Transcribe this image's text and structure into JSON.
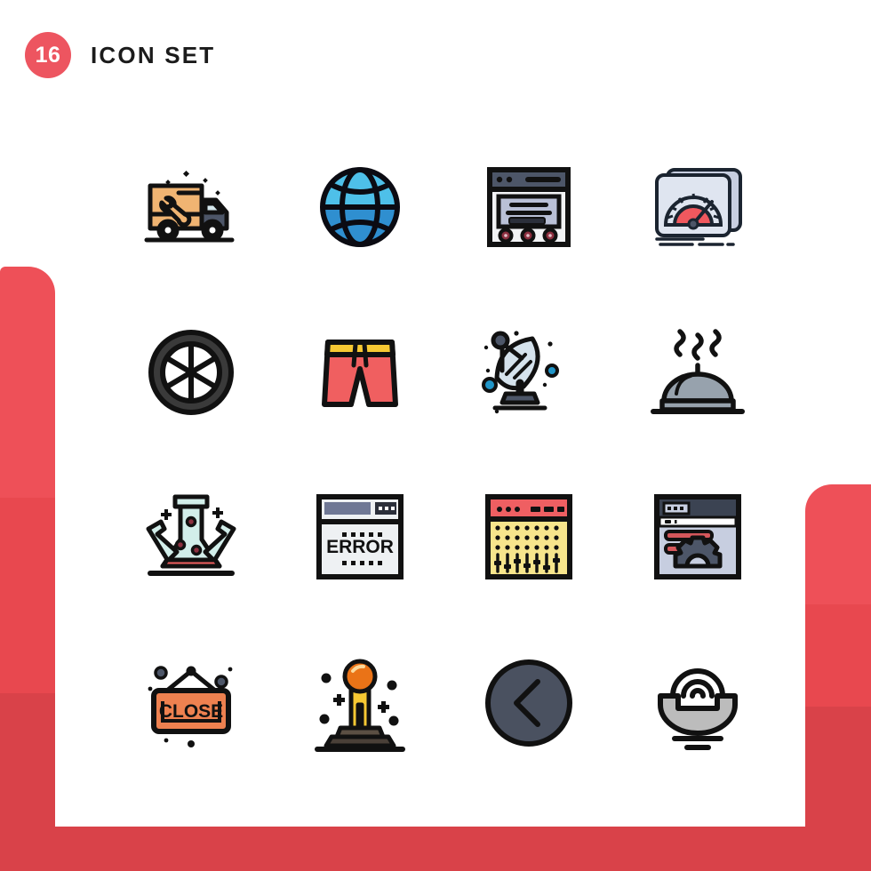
{
  "header": {
    "count": "16",
    "title": "Icon Set",
    "badge_color": "#ed5560",
    "title_color": "#1b1b1b"
  },
  "decor": {
    "ribbon_color": "#ee5058",
    "ribbon_shade_a": "#e8484f",
    "ribbon_shade_b": "#d94249",
    "background": "#ffffff"
  },
  "grid": {
    "columns": 4,
    "rows": 4,
    "total_icons": 16
  },
  "icons": [
    {
      "index": 1,
      "row": 1,
      "col": 1,
      "name": "service-truck-icon",
      "label": "Service Truck",
      "colors": {
        "body": "#f0b472",
        "cab": "#4d5668",
        "window": "#d6e9ee",
        "stroke": "#111111"
      }
    },
    {
      "index": 2,
      "row": 1,
      "col": 2,
      "name": "globe-icon",
      "label": "Globe",
      "colors": {
        "light": "#4ec0e9",
        "mid": "#3aa8dd",
        "dark": "#2f8fd0",
        "stroke": "#0b0b12"
      }
    },
    {
      "index": 3,
      "row": 1,
      "col": 3,
      "name": "web-page-icon",
      "label": "Web Page",
      "colors": {
        "titlebar": "#4d5668",
        "content": "#b9c0d6",
        "base": "#f2f3f5",
        "dot": "#8c2f3f",
        "stroke": "#111111"
      }
    },
    {
      "index": 4,
      "row": 1,
      "col": 4,
      "name": "speedometer-icon",
      "label": "Speedometer",
      "colors": {
        "case": "#c7cee0",
        "face": "#dfe5f0",
        "dial": "#f0585e",
        "stroke": "#1b2430"
      }
    },
    {
      "index": 5,
      "row": 2,
      "col": 1,
      "name": "wheel-icon",
      "label": "Wheel",
      "colors": {
        "tire": "#3a3a3a",
        "stroke": "#111111"
      }
    },
    {
      "index": 6,
      "row": 2,
      "col": 2,
      "name": "shorts-icon",
      "label": "Shorts",
      "colors": {
        "fabric": "#f05f60",
        "waistband": "#f6c833",
        "stroke": "#111111"
      }
    },
    {
      "index": 7,
      "row": 2,
      "col": 3,
      "name": "satellite-dish-icon",
      "label": "Satellite Dish",
      "colors": {
        "dish": "#d5e2ec",
        "stand": "#4d5668",
        "accent": "#2196c9",
        "stroke": "#111111"
      }
    },
    {
      "index": 8,
      "row": 2,
      "col": 4,
      "name": "food-cloche-icon",
      "label": "Food Cloche",
      "colors": {
        "dome": "#97a2ad",
        "stroke": "#111111"
      }
    },
    {
      "index": 9,
      "row": 3,
      "col": 1,
      "name": "lab-flask-icon",
      "label": "Laboratory Flask",
      "colors": {
        "glass": "#d2eeea",
        "liquid": "#f05f60",
        "bubble": "#8c2f3f",
        "stroke": "#111111"
      }
    },
    {
      "index": 10,
      "row": 3,
      "col": 2,
      "name": "error-page-icon",
      "label": "Error Page",
      "text": "ERROR",
      "colors": {
        "titlebar": "#6f7895",
        "content": "#eef1f3",
        "stroke": "#111111"
      }
    },
    {
      "index": 11,
      "row": 3,
      "col": 3,
      "name": "equalizer-icon",
      "label": "Equalizer",
      "colors": {
        "titlebar": "#ef5f62",
        "content": "#f7e58c",
        "stroke": "#111111"
      }
    },
    {
      "index": 12,
      "row": 3,
      "col": 4,
      "name": "settings-page-icon",
      "label": "Settings Page",
      "colors": {
        "titlebar": "#3b4352",
        "content": "#c7cee0",
        "field": "#d4575b",
        "gear": "#4d5668",
        "stroke": "#111111"
      }
    },
    {
      "index": 13,
      "row": 4,
      "col": 1,
      "name": "close-sign-icon",
      "label": "Close Sign",
      "text": "CLOSE",
      "colors": {
        "board": "#ee8150",
        "stroke": "#111111"
      }
    },
    {
      "index": 14,
      "row": 4,
      "col": 2,
      "name": "trophy-statue-icon",
      "label": "Trophy Statue",
      "colors": {
        "sphere": "#ea7317",
        "column": "#f6c833",
        "base": "#5b4f43",
        "stroke": "#111111"
      }
    },
    {
      "index": 15,
      "row": 4,
      "col": 3,
      "name": "chevron-left-circle-icon",
      "label": "Back Arrow",
      "colors": {
        "circle": "#4a5160",
        "stroke": "#111111"
      }
    },
    {
      "index": 16,
      "row": 4,
      "col": 4,
      "name": "telephone-signal-icon",
      "label": "Telephone Signal",
      "colors": {
        "handset": "#bcbcbc",
        "stroke": "#111111"
      }
    }
  ]
}
